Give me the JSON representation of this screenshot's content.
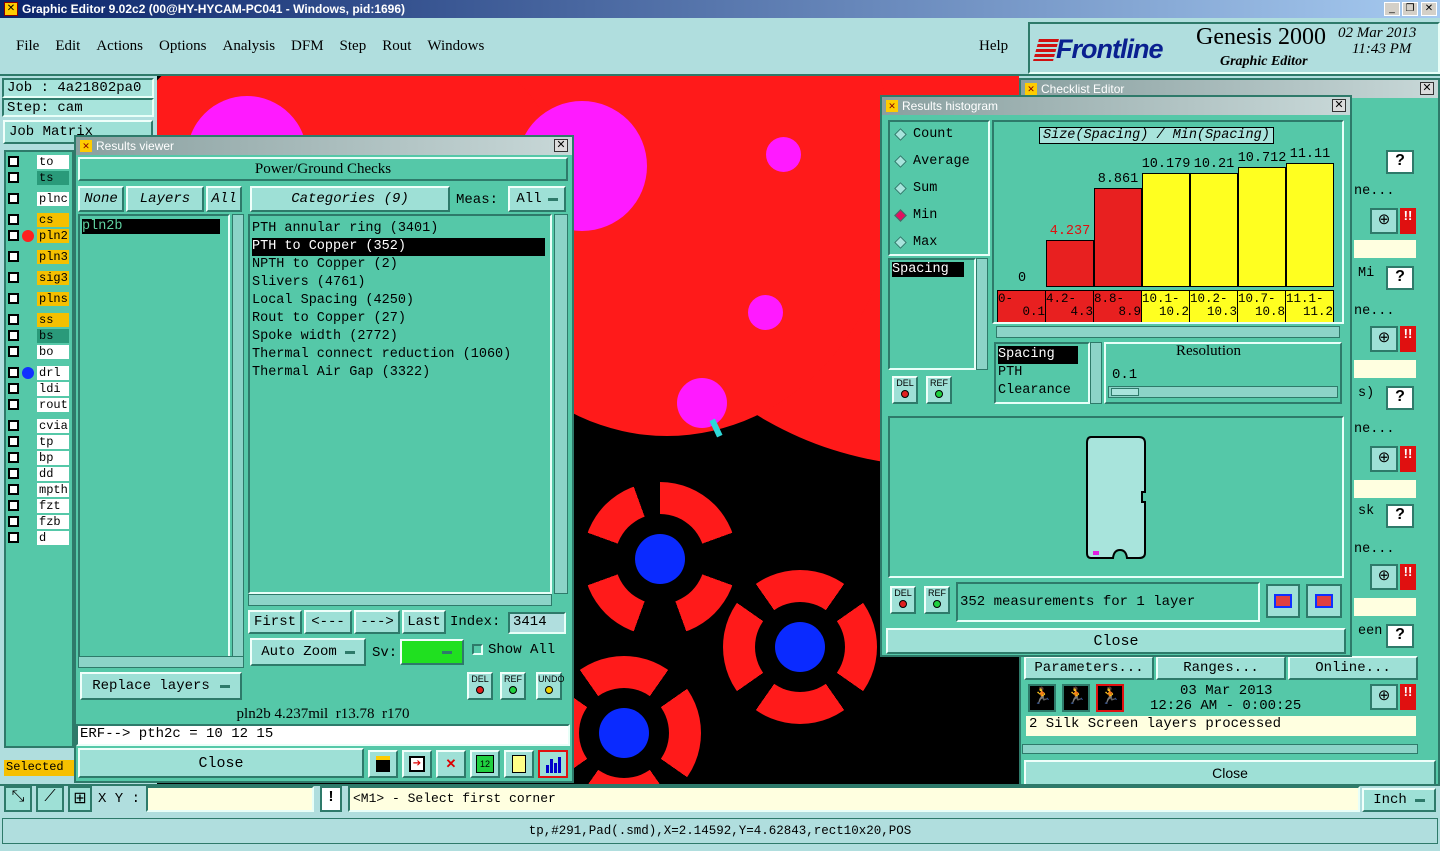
{
  "window_title": "Graphic Editor 9.02c2 (00@HY-HYCAM-PC041 - Windows, pid:1696)",
  "menu": [
    "File",
    "Edit",
    "Actions",
    "Options",
    "Analysis",
    "DFM",
    "Step",
    "Rout",
    "Windows"
  ],
  "help": "Help",
  "brand": {
    "logo": "Frontline",
    "product": "Genesis 2000",
    "subtitle": "Graphic Editor",
    "date": "02 Mar 2013",
    "time": "11:43 PM"
  },
  "job": {
    "job_label": "Job : 4a21802pa0",
    "step_label": "Step: cam",
    "matrix": "Job Matrix"
  },
  "layers": [
    "to",
    "ts",
    "plnc",
    "cs",
    "pln2",
    "pln3",
    "sig3",
    "plns",
    "ss",
    "bs",
    "bo",
    "drl",
    "ldi",
    "rout",
    "cvia",
    "tp",
    "bp",
    "dd",
    "mpth",
    "fzt",
    "fzb",
    "d"
  ],
  "selected_label": "Selected",
  "results_viewer": {
    "title": "Results viewer",
    "header": "Power/Ground Checks",
    "none": "None",
    "layers": "Layers",
    "all": "All",
    "categories": "Categories (9)",
    "meas_label": "Meas:",
    "meas_value": "All",
    "layer_items": [
      "pln2b"
    ],
    "category_items": [
      "PTH annular ring (3401)",
      "PTH to Copper (352)",
      "NPTH to Copper (2)",
      "Slivers (4761)",
      "Local Spacing (4250)",
      "Rout to Copper (27)",
      "Spoke width (2772)",
      "Thermal connect reduction (1060)",
      "Thermal Air Gap (3322)"
    ],
    "first": "First",
    "prev": "<---",
    "next": "--->",
    "last": "Last",
    "index_label": "Index:",
    "index_value": "3414",
    "auto_zoom": "Auto Zoom",
    "sv_label": "Sv:",
    "show_all": "Show All",
    "replace_layers": "Replace layers",
    "status": "pln2b 4.237mil  r13.78  r170",
    "erf": "ERF--> pth2c = 10 12 15",
    "close": "Close",
    "del": "DEL",
    "ref": "REF",
    "undo": "UNDO"
  },
  "histogram": {
    "title": "Results histogram",
    "modes": [
      "Count",
      "Average",
      "Sum",
      "Min",
      "Max"
    ],
    "selected_mode": "Min",
    "chart_title": "Size(Spacing) / Min(Spacing)",
    "list_items": [
      "Spacing"
    ],
    "fields": [
      "Spacing",
      "PTH",
      "Clearance"
    ],
    "resolution_label": "Resolution",
    "resolution_value": "0.1",
    "summary": "352 measurements for 1 layer",
    "close": "Close",
    "del": "DEL",
    "ref": "REF"
  },
  "chart_data": {
    "type": "bar",
    "title": "Size(Spacing) / Min(Spacing)",
    "categories": [
      "0-0.1",
      "4.2-4.3",
      "8.8-8.9",
      "10.1-10.2",
      "10.2-10.3",
      "10.7-10.8",
      "11.1-11.2"
    ],
    "values": [
      0,
      4.237,
      8.861,
      10.179,
      10.21,
      10.712,
      11.11
    ],
    "value_labels": [
      "0",
      "4.237",
      "8.861",
      "10.179",
      "10.21",
      "10.712",
      "11.11"
    ],
    "bin_labels_top": [
      "0-",
      "4.2-",
      "8.8-",
      "10.1-",
      "10.2-",
      "10.7-",
      "11.1-"
    ],
    "bin_labels_bottom": [
      "0.1",
      "4.3",
      "8.9",
      "10.2",
      "10.3",
      "10.8",
      "11.2"
    ],
    "colors": [
      "#e82020",
      "#e82020",
      "#e82020",
      "#ffff20",
      "#ffff20",
      "#ffff20",
      "#ffff20"
    ]
  },
  "checklist": {
    "title": "Checklist Editor",
    "partial_labels": [
      "ne...",
      "Mi",
      "ne...",
      "s)",
      "ne...",
      "sk",
      "ne...",
      "een"
    ],
    "parameters": "Parameters...",
    "ranges": "Ranges...",
    "online": "Online...",
    "date": "03 Mar 2013",
    "time": "12:26 AM - 0:00:25",
    "message": "2 Silk Screen layers processed",
    "close": "Close"
  },
  "bottom": {
    "xy_label": "X Y :",
    "xy_value": "",
    "prompt": "<M1> - Select first corner",
    "units": "Inch",
    "status": "tp,#291,Pad(.smd),X=2.14592,Y=4.62843,rect10x20,POS"
  },
  "colors": {
    "teal": "#55c8a8",
    "light_teal": "#b0dede",
    "red": "#ff1a1a",
    "magenta": "#ff1aff",
    "blue": "#0a2aff"
  }
}
